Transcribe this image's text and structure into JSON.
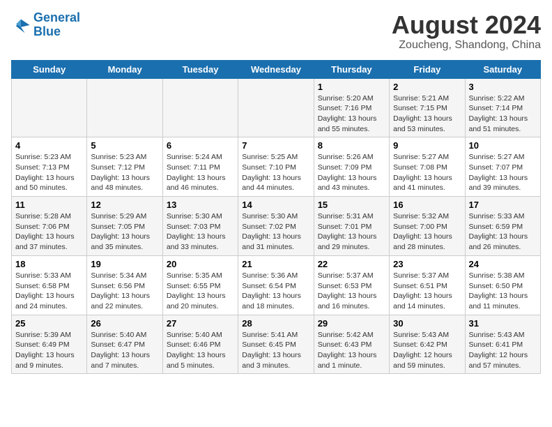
{
  "logo": {
    "line1": "General",
    "line2": "Blue"
  },
  "title": "August 2024",
  "subtitle": "Zoucheng, Shandong, China",
  "days_of_week": [
    "Sunday",
    "Monday",
    "Tuesday",
    "Wednesday",
    "Thursday",
    "Friday",
    "Saturday"
  ],
  "weeks": [
    [
      {
        "day": "",
        "info": ""
      },
      {
        "day": "",
        "info": ""
      },
      {
        "day": "",
        "info": ""
      },
      {
        "day": "",
        "info": ""
      },
      {
        "day": "1",
        "info": "Sunrise: 5:20 AM\nSunset: 7:16 PM\nDaylight: 13 hours\nand 55 minutes."
      },
      {
        "day": "2",
        "info": "Sunrise: 5:21 AM\nSunset: 7:15 PM\nDaylight: 13 hours\nand 53 minutes."
      },
      {
        "day": "3",
        "info": "Sunrise: 5:22 AM\nSunset: 7:14 PM\nDaylight: 13 hours\nand 51 minutes."
      }
    ],
    [
      {
        "day": "4",
        "info": "Sunrise: 5:23 AM\nSunset: 7:13 PM\nDaylight: 13 hours\nand 50 minutes."
      },
      {
        "day": "5",
        "info": "Sunrise: 5:23 AM\nSunset: 7:12 PM\nDaylight: 13 hours\nand 48 minutes."
      },
      {
        "day": "6",
        "info": "Sunrise: 5:24 AM\nSunset: 7:11 PM\nDaylight: 13 hours\nand 46 minutes."
      },
      {
        "day": "7",
        "info": "Sunrise: 5:25 AM\nSunset: 7:10 PM\nDaylight: 13 hours\nand 44 minutes."
      },
      {
        "day": "8",
        "info": "Sunrise: 5:26 AM\nSunset: 7:09 PM\nDaylight: 13 hours\nand 43 minutes."
      },
      {
        "day": "9",
        "info": "Sunrise: 5:27 AM\nSunset: 7:08 PM\nDaylight: 13 hours\nand 41 minutes."
      },
      {
        "day": "10",
        "info": "Sunrise: 5:27 AM\nSunset: 7:07 PM\nDaylight: 13 hours\nand 39 minutes."
      }
    ],
    [
      {
        "day": "11",
        "info": "Sunrise: 5:28 AM\nSunset: 7:06 PM\nDaylight: 13 hours\nand 37 minutes."
      },
      {
        "day": "12",
        "info": "Sunrise: 5:29 AM\nSunset: 7:05 PM\nDaylight: 13 hours\nand 35 minutes."
      },
      {
        "day": "13",
        "info": "Sunrise: 5:30 AM\nSunset: 7:03 PM\nDaylight: 13 hours\nand 33 minutes."
      },
      {
        "day": "14",
        "info": "Sunrise: 5:30 AM\nSunset: 7:02 PM\nDaylight: 13 hours\nand 31 minutes."
      },
      {
        "day": "15",
        "info": "Sunrise: 5:31 AM\nSunset: 7:01 PM\nDaylight: 13 hours\nand 29 minutes."
      },
      {
        "day": "16",
        "info": "Sunrise: 5:32 AM\nSunset: 7:00 PM\nDaylight: 13 hours\nand 28 minutes."
      },
      {
        "day": "17",
        "info": "Sunrise: 5:33 AM\nSunset: 6:59 PM\nDaylight: 13 hours\nand 26 minutes."
      }
    ],
    [
      {
        "day": "18",
        "info": "Sunrise: 5:33 AM\nSunset: 6:58 PM\nDaylight: 13 hours\nand 24 minutes."
      },
      {
        "day": "19",
        "info": "Sunrise: 5:34 AM\nSunset: 6:56 PM\nDaylight: 13 hours\nand 22 minutes."
      },
      {
        "day": "20",
        "info": "Sunrise: 5:35 AM\nSunset: 6:55 PM\nDaylight: 13 hours\nand 20 minutes."
      },
      {
        "day": "21",
        "info": "Sunrise: 5:36 AM\nSunset: 6:54 PM\nDaylight: 13 hours\nand 18 minutes."
      },
      {
        "day": "22",
        "info": "Sunrise: 5:37 AM\nSunset: 6:53 PM\nDaylight: 13 hours\nand 16 minutes."
      },
      {
        "day": "23",
        "info": "Sunrise: 5:37 AM\nSunset: 6:51 PM\nDaylight: 13 hours\nand 14 minutes."
      },
      {
        "day": "24",
        "info": "Sunrise: 5:38 AM\nSunset: 6:50 PM\nDaylight: 13 hours\nand 11 minutes."
      }
    ],
    [
      {
        "day": "25",
        "info": "Sunrise: 5:39 AM\nSunset: 6:49 PM\nDaylight: 13 hours\nand 9 minutes."
      },
      {
        "day": "26",
        "info": "Sunrise: 5:40 AM\nSunset: 6:47 PM\nDaylight: 13 hours\nand 7 minutes."
      },
      {
        "day": "27",
        "info": "Sunrise: 5:40 AM\nSunset: 6:46 PM\nDaylight: 13 hours\nand 5 minutes."
      },
      {
        "day": "28",
        "info": "Sunrise: 5:41 AM\nSunset: 6:45 PM\nDaylight: 13 hours\nand 3 minutes."
      },
      {
        "day": "29",
        "info": "Sunrise: 5:42 AM\nSunset: 6:43 PM\nDaylight: 13 hours\nand 1 minute."
      },
      {
        "day": "30",
        "info": "Sunrise: 5:43 AM\nSunset: 6:42 PM\nDaylight: 12 hours\nand 59 minutes."
      },
      {
        "day": "31",
        "info": "Sunrise: 5:43 AM\nSunset: 6:41 PM\nDaylight: 12 hours\nand 57 minutes."
      }
    ]
  ]
}
